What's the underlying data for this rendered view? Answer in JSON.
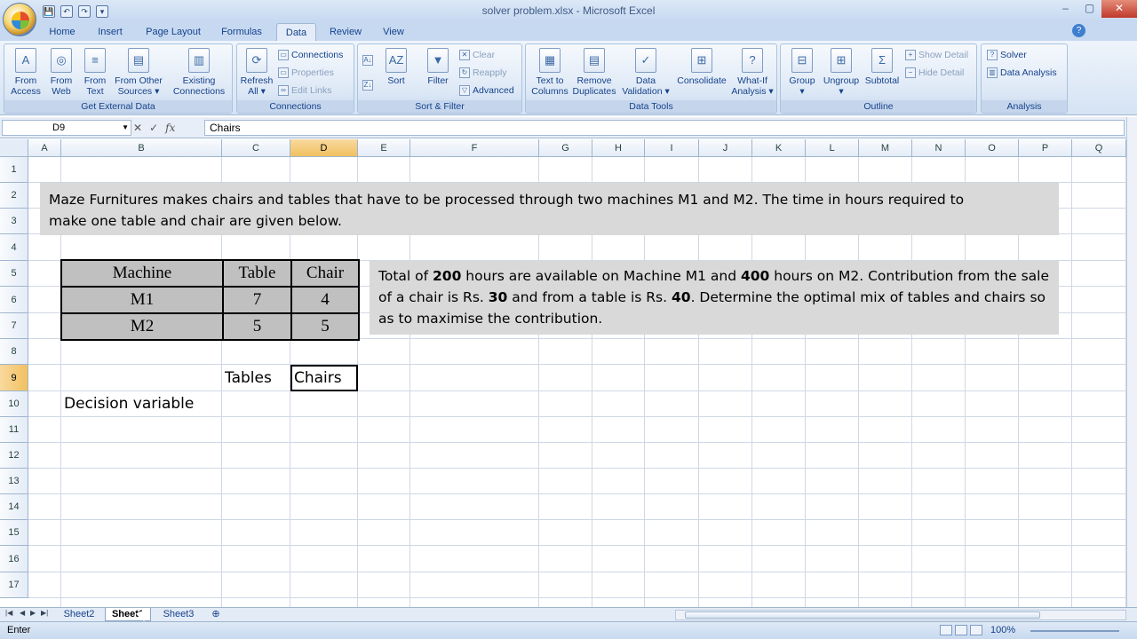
{
  "window": {
    "title": "solver problem.xlsx - Microsoft Excel",
    "help": "?",
    "minimize": "–",
    "restore": "▢",
    "close": "✕"
  },
  "qat": {
    "save": "💾",
    "undo": "↶",
    "redo": "↷",
    "customize": "▾"
  },
  "tabs": [
    "Home",
    "Insert",
    "Page Layout",
    "Formulas",
    "Data",
    "Review",
    "View"
  ],
  "active_tab": "Data",
  "ribbon": {
    "get_external_data": {
      "label": "Get External Data",
      "buttons": [
        "From\nAccess",
        "From\nWeb",
        "From\nText",
        "From Other\nSources ▾",
        "Existing\nConnections"
      ]
    },
    "connections": {
      "label": "Connections",
      "refresh": "Refresh\nAll ▾",
      "items": [
        "Connections",
        "Properties",
        "Edit Links"
      ]
    },
    "sort_filter": {
      "label": "Sort & Filter",
      "sort": "Sort",
      "filter": "Filter",
      "items": [
        "Clear",
        "Reapply",
        "Advanced"
      ]
    },
    "data_tools": {
      "label": "Data Tools",
      "buttons": [
        "Text to\nColumns",
        "Remove\nDuplicates",
        "Data\nValidation ▾",
        "Consolidate",
        "What-If\nAnalysis ▾"
      ]
    },
    "outline": {
      "label": "Outline",
      "buttons": [
        "Group\n▾",
        "Ungroup\n▾",
        "Subtotal"
      ],
      "items": [
        "Show Detail",
        "Hide Detail"
      ]
    },
    "analysis": {
      "label": "Analysis",
      "items": [
        "Solver",
        "Data Analysis"
      ]
    }
  },
  "formula_bar": {
    "name_box": "D9",
    "fx": "fx",
    "value": "Chairs"
  },
  "columns": [
    "A",
    "B",
    "C",
    "D",
    "E",
    "F",
    "G",
    "H",
    "I",
    "J",
    "K",
    "L",
    "M",
    "N",
    "O",
    "P",
    "Q"
  ],
  "rows": [
    "1",
    "2",
    "3",
    "4",
    "5",
    "6",
    "7",
    "8",
    "9",
    "10",
    "11",
    "12",
    "13",
    "14",
    "15",
    "16",
    "17"
  ],
  "selected_column": "D",
  "selected_row": "9",
  "problem_text": {
    "line1": "Maze Furnitures makes chairs and tables that have to be processed through two machines M1 and M2. The time in hours required to",
    "line2": "make one table and chair are given below."
  },
  "machine_table": {
    "headers": [
      "Machine",
      "Table",
      "Chair"
    ],
    "rows": [
      [
        "M1",
        "7",
        "4"
      ],
      [
        "M2",
        "5",
        "5"
      ]
    ]
  },
  "constraint_text": {
    "p1": "Total of ",
    "b1": "200",
    "p2": " hours are available on Machine M1 and ",
    "b2": "400",
    "p3": " hours on M2. Contribution from the sale of a chair is Rs. ",
    "b3": "30",
    "p4": " and from a table is Rs. ",
    "b4": "40",
    "p5": ". Determine the optimal mix of tables and chairs so as to maximise the contribution."
  },
  "cells": {
    "c9": "Tables",
    "d9": "Chairs",
    "b10": "Decision variable"
  },
  "sheet_tabs": [
    "Sheet2",
    "Sheet1",
    "Sheet3"
  ],
  "active_sheet": "Sheet1",
  "status": {
    "mode": "Enter",
    "zoom": "100%"
  }
}
